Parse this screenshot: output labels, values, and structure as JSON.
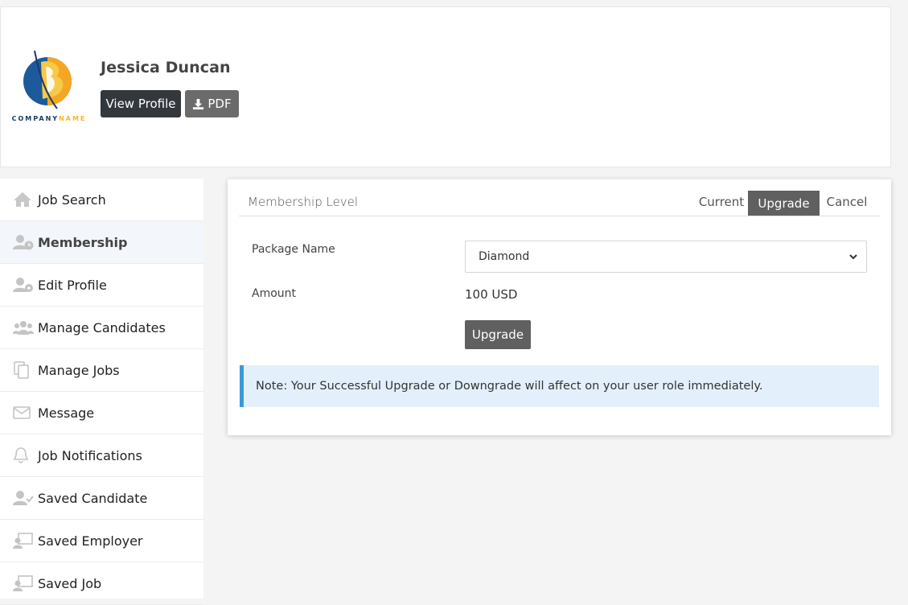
{
  "header": {
    "logo_text_main": "COMPANY",
    "logo_text_accent": "NAME",
    "user_name": "Jessica Duncan",
    "view_profile_label": "View Profile",
    "pdf_label": "PDF"
  },
  "sidebar": {
    "items": [
      {
        "label": "Job Search",
        "icon": "home-icon"
      },
      {
        "label": "Membership",
        "icon": "user-clock-icon",
        "active": true
      },
      {
        "label": "Edit Profile",
        "icon": "user-gear-icon"
      },
      {
        "label": "Manage Candidates",
        "icon": "users-icon"
      },
      {
        "label": "Manage Jobs",
        "icon": "copy-icon"
      },
      {
        "label": "Message",
        "icon": "envelope-icon"
      },
      {
        "label": "Job Notifications",
        "icon": "bell-icon"
      },
      {
        "label": "Saved Candidate",
        "icon": "user-check-icon"
      },
      {
        "label": "Saved Employer",
        "icon": "chalkboard-user-icon"
      },
      {
        "label": "Saved Job",
        "icon": "chalkboard-user-icon"
      }
    ]
  },
  "membership": {
    "title": "Membership Level",
    "tabs": {
      "current": "Current",
      "upgrade": "Upgrade",
      "cancel": "Cancel"
    },
    "active_tab": "Upgrade",
    "package_label": "Package Name",
    "package_value": "Diamond",
    "amount_label": "Amount",
    "amount_value": "100 USD",
    "upgrade_button": "Upgrade",
    "note": "Note: Your Successful Upgrade or Downgrade will affect on your user role immediately."
  },
  "colors": {
    "dark_button": "#33383d",
    "gray_button": "#606060",
    "note_bg": "#e3f0fb",
    "note_border": "#3a9ad9"
  }
}
